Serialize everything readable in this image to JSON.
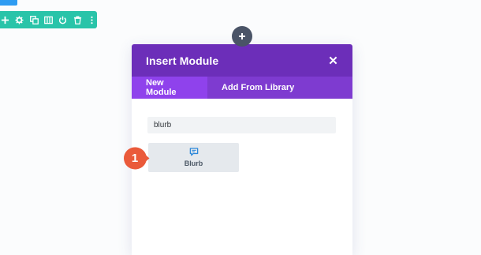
{
  "modal": {
    "title": "Insert Module",
    "tabs": [
      {
        "label": "New Module",
        "active": true
      },
      {
        "label": "Add From Library",
        "active": false
      }
    ],
    "search": {
      "value": "blurb",
      "placeholder": ""
    },
    "results": [
      {
        "label": "Blurb",
        "icon": "blurb-icon"
      }
    ]
  },
  "callout": {
    "number": "1"
  },
  "toolbar": {
    "icons": [
      "add-icon",
      "gear-icon",
      "duplicate-icon",
      "columns-icon",
      "power-icon",
      "trash-icon",
      "more-icon"
    ]
  },
  "colors": {
    "header": "#6c2eb9",
    "tab_bar": "#7e3bd0",
    "tab_active": "#8f42ec",
    "row_toolbar": "#29c4a9",
    "callout": "#ea5a3a",
    "add_button": "#4a5467",
    "icon_blue": "#2b87da"
  }
}
